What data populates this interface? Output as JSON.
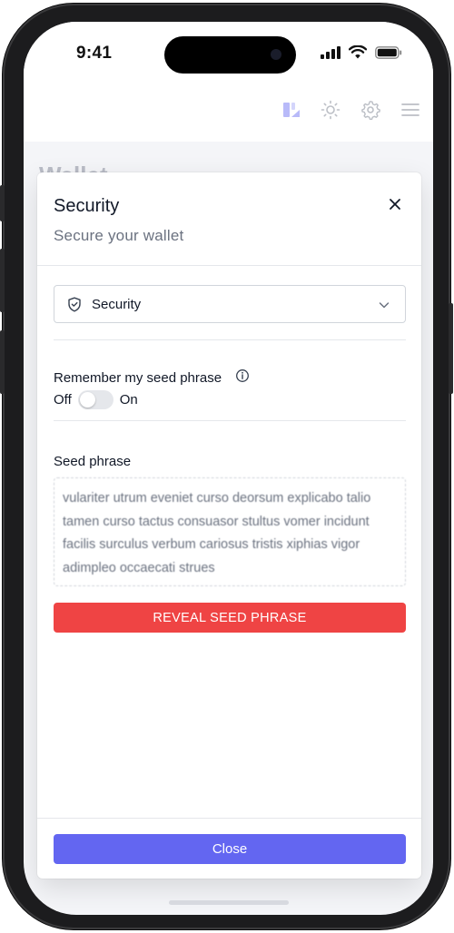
{
  "status_bar": {
    "time": "9:41"
  },
  "background": {
    "page_title": "Wallet"
  },
  "modal": {
    "title": "Security",
    "subtitle": "Secure your wallet",
    "select": {
      "selected": "Security",
      "icon": "shield-icon"
    },
    "remember": {
      "label": "Remember my seed phrase",
      "off_label": "Off",
      "on_label": "On",
      "enabled": false
    },
    "seed": {
      "label": "Seed phrase",
      "phrase": "vulariter utrum eveniet curso deorsum explicabo talio tamen curso tactus consuasor stultus vomer incidunt facilis surculus verbum cariosus tristis xiphias vigor adimpleo occaecati strues"
    },
    "reveal_label": "REVEAL SEED PHRASE",
    "close_label": "Close"
  },
  "colors": {
    "danger": "#ef4444",
    "primary": "#6366f1",
    "header_icon_accent": "#6366f1"
  }
}
